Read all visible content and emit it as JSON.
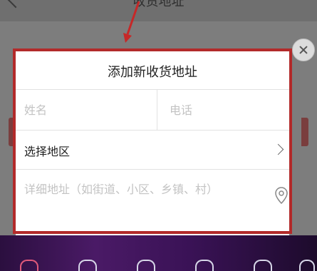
{
  "background": {
    "page_title": "收货地址"
  },
  "dialog": {
    "title": "添加新收货地址",
    "name_placeholder": "姓名",
    "phone_placeholder": "电话",
    "region_label": "选择地区",
    "address_placeholder": "详细地址（如街道、小区、乡镇、村）"
  },
  "icons": {
    "close": "close-icon",
    "chevron": "chevron-right-icon",
    "location": "location-pin-icon"
  },
  "colors": {
    "highlight_frame": "#b22a2a",
    "overlay": "#7b7b7b",
    "taskbar": "#3a1256"
  }
}
